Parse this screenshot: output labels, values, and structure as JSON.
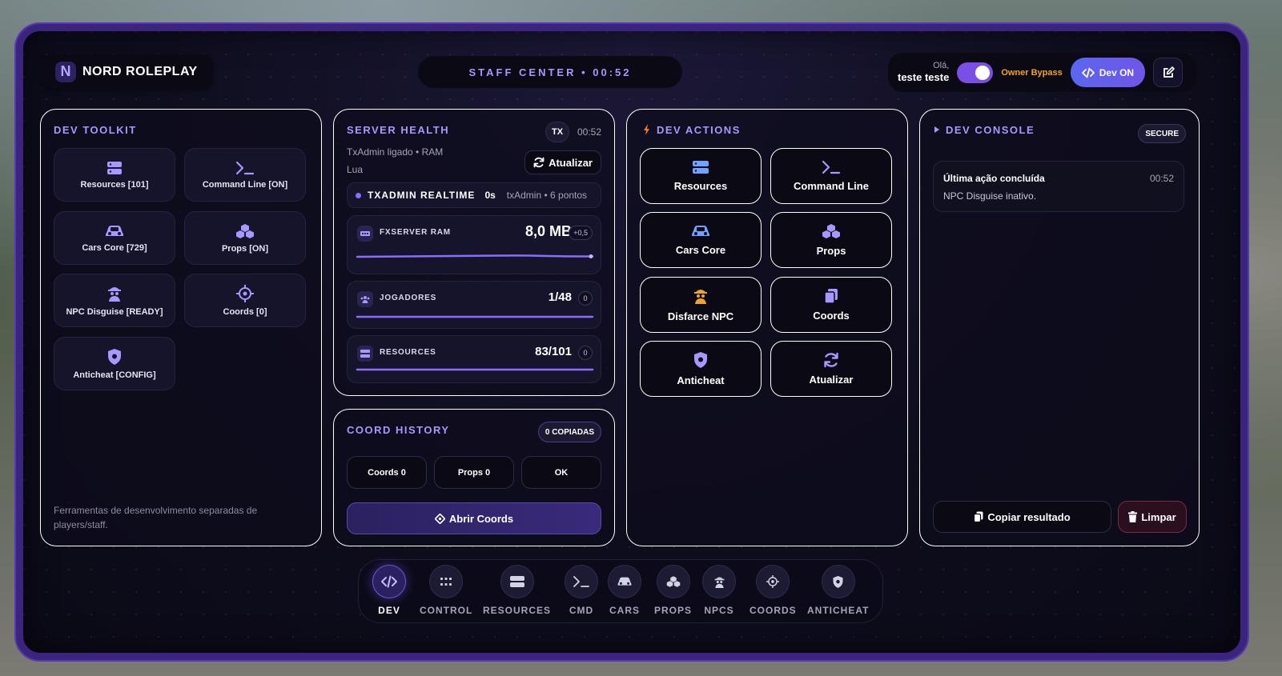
{
  "header": {
    "brand_letter": "N",
    "brand_name": "NORD ROLEPLAY",
    "staff_center": "STAFF CENTER • 00:52",
    "greeting": "Olá,",
    "user": "teste teste",
    "owner_bypass": "Owner Bypass",
    "dev_on": "Dev ON"
  },
  "toolkit": {
    "title": "DEV TOOLKIT",
    "tiles": [
      {
        "label": "Resources [101]",
        "icon": "server-icon"
      },
      {
        "label": "Command Line [ON]",
        "icon": "terminal-icon"
      },
      {
        "label": "Cars Core [729]",
        "icon": "car-icon"
      },
      {
        "label": "Props [ON]",
        "icon": "cubes-icon"
      },
      {
        "label": "NPC Disguise [READY]",
        "icon": "disguise-icon"
      },
      {
        "label": "Coords [0]",
        "icon": "crosshair-icon"
      },
      {
        "label": "Anticheat [CONFIG]",
        "icon": "shield-icon"
      }
    ],
    "note": "Ferramentas de desenvolvimento separadas de players/staff."
  },
  "health": {
    "title": "SERVER HEALTH",
    "badge": "TX",
    "time": "00:52",
    "subtitle_1": "TxAdmin ligado • RAM",
    "subtitle_2": "Lua",
    "refresh": "Atualizar",
    "realtime_label": "TXADMIN REALTIME",
    "realtime_value": "0s",
    "realtime_source": "txAdmin • 6 pontos",
    "metrics": [
      {
        "label": "FXSERVER RAM",
        "value": "8,0 MB",
        "delta": "+0,5"
      },
      {
        "label": "JOGADORES",
        "value": "1/48",
        "delta": "0"
      },
      {
        "label": "RESOURCES",
        "value": "83/101",
        "delta": "0"
      }
    ]
  },
  "coord_history": {
    "title": "COORD HISTORY",
    "badge": "0 COPIADAS",
    "buttons": [
      "Coords 0",
      "Props 0",
      "OK"
    ],
    "open": "Abrir Coords"
  },
  "actions": {
    "title": "DEV ACTIONS",
    "items": [
      {
        "label": "Resources",
        "icon": "server-icon"
      },
      {
        "label": "Command Line",
        "icon": "terminal-icon"
      },
      {
        "label": "Cars Core",
        "icon": "car-icon"
      },
      {
        "label": "Props",
        "icon": "cubes-icon"
      },
      {
        "label": "Disfarce NPC",
        "icon": "disguise-icon"
      },
      {
        "label": "Coords",
        "icon": "copy-icon"
      },
      {
        "label": "Anticheat",
        "icon": "shield-icon"
      },
      {
        "label": "Atualizar",
        "icon": "refresh-icon"
      }
    ]
  },
  "console": {
    "title": "DEV CONSOLE",
    "badge": "SECURE",
    "log_title": "Última ação concluída",
    "log_time": "00:52",
    "log_message": "NPC Disguise inativo.",
    "copy": "Copiar resultado",
    "clear": "Limpar"
  },
  "dock": {
    "items": [
      {
        "label": "DEV",
        "icon": "code-icon",
        "active": true
      },
      {
        "label": "CONTROL",
        "icon": "grid-icon"
      },
      {
        "label": "RESOURCES",
        "icon": "server-icon"
      },
      {
        "label": "CMD",
        "icon": "terminal-icon"
      },
      {
        "label": "CARS",
        "icon": "car-icon"
      },
      {
        "label": "PROPS",
        "icon": "cubes-icon"
      },
      {
        "label": "NPCS",
        "icon": "disguise-icon"
      },
      {
        "label": "COORDS",
        "icon": "crosshair-icon"
      },
      {
        "label": "ANTICHEAT",
        "icon": "shield-icon"
      }
    ]
  },
  "colors": {
    "accent": "#a897ff",
    "frame": "#3a2480",
    "owner": "#f0a22a",
    "action_icon": "#6fa3ff"
  }
}
